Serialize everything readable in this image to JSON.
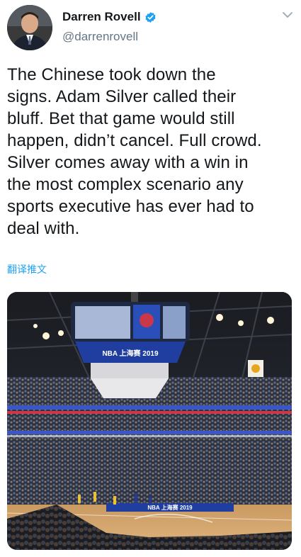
{
  "author": {
    "display_name": "Darren Rovell",
    "handle": "@darrenrovell",
    "verified": true,
    "avatar_icon": "person-avatar"
  },
  "tweet": {
    "text": "The Chinese took down the\nsigns. Adam Silver called their\nbluff. Bet that game would still\nhappen, didn’t cancel. Full crowd.\nSilver comes away with a win in\nthe most complex scenario any\nsports executive has ever had to\ndeal with.",
    "translate_label": "翻译推文"
  },
  "media": {
    "type": "photo",
    "scoreboard_text": "NBA 上海赛 2019",
    "court_banner_text": "NBA 上海赛 2019",
    "icon": "basketball-arena-photo"
  },
  "colors": {
    "accent": "#1da1f2",
    "text": "#14171a",
    "secondary": "#657786"
  }
}
